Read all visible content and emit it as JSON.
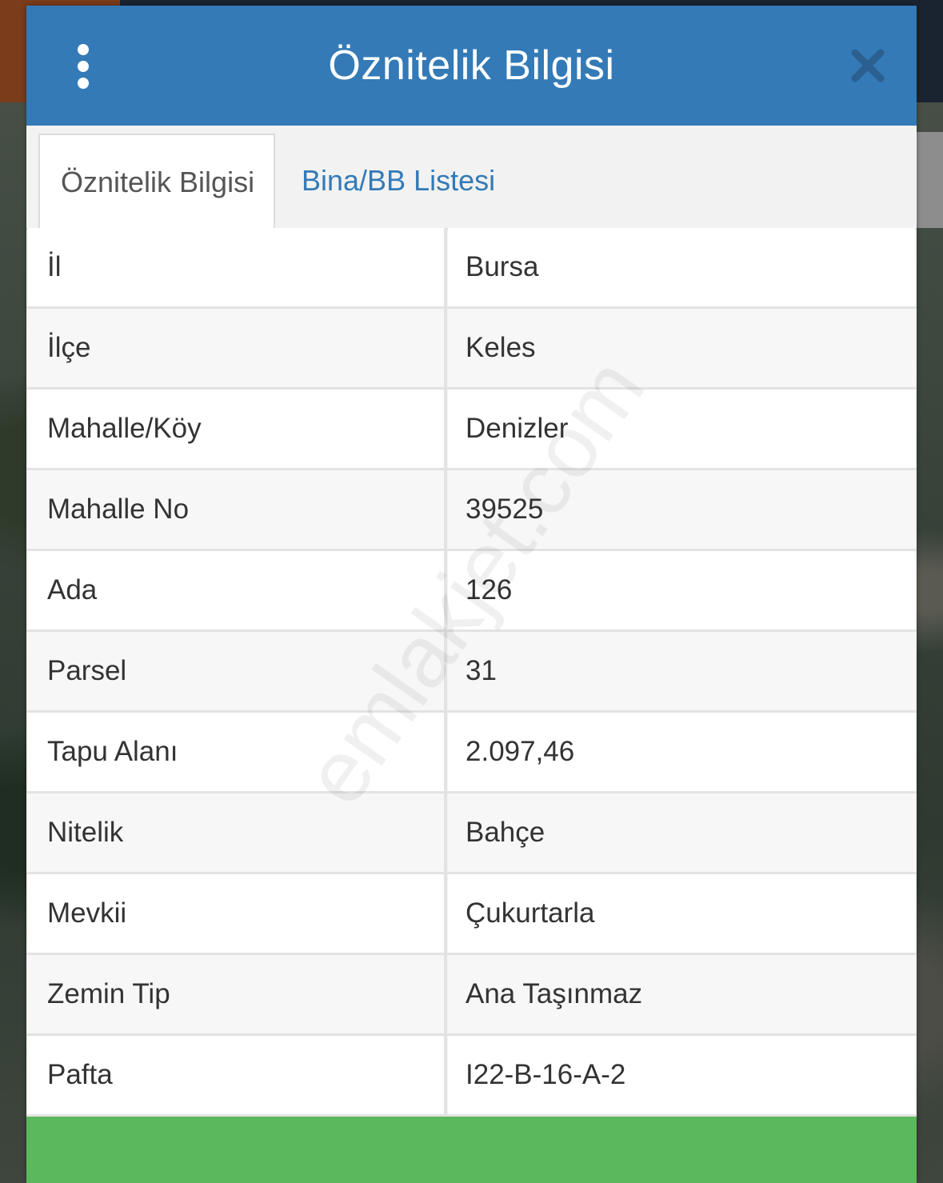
{
  "header": {
    "title": "Öznitelik Bilgisi"
  },
  "tabs": [
    {
      "label": "Öznitelik Bilgisi",
      "active": true
    },
    {
      "label": "Bina/BB Listesi",
      "active": false
    }
  ],
  "attributes": [
    {
      "key": "İl",
      "value": "Bursa"
    },
    {
      "key": "İlçe",
      "value": "Keles"
    },
    {
      "key": "Mahalle/Köy",
      "value": "Denizler"
    },
    {
      "key": "Mahalle No",
      "value": "39525"
    },
    {
      "key": "Ada",
      "value": "126"
    },
    {
      "key": "Parsel",
      "value": "31"
    },
    {
      "key": "Tapu Alanı",
      "value": "2.097,46"
    },
    {
      "key": "Nitelik",
      "value": "Bahçe"
    },
    {
      "key": "Mevkii",
      "value": "Çukurtarla"
    },
    {
      "key": "Zemin Tip",
      "value": "Ana Taşınmaz"
    },
    {
      "key": "Pafta",
      "value": "I22-B-16-A-2"
    }
  ],
  "watermark": "emlakjet.com",
  "colors": {
    "header": "#337ab7",
    "footer": "#5cb85c",
    "tab_link": "#337ab7"
  },
  "icons": {
    "menu": "vertical-dots-icon",
    "close": "close-icon"
  }
}
